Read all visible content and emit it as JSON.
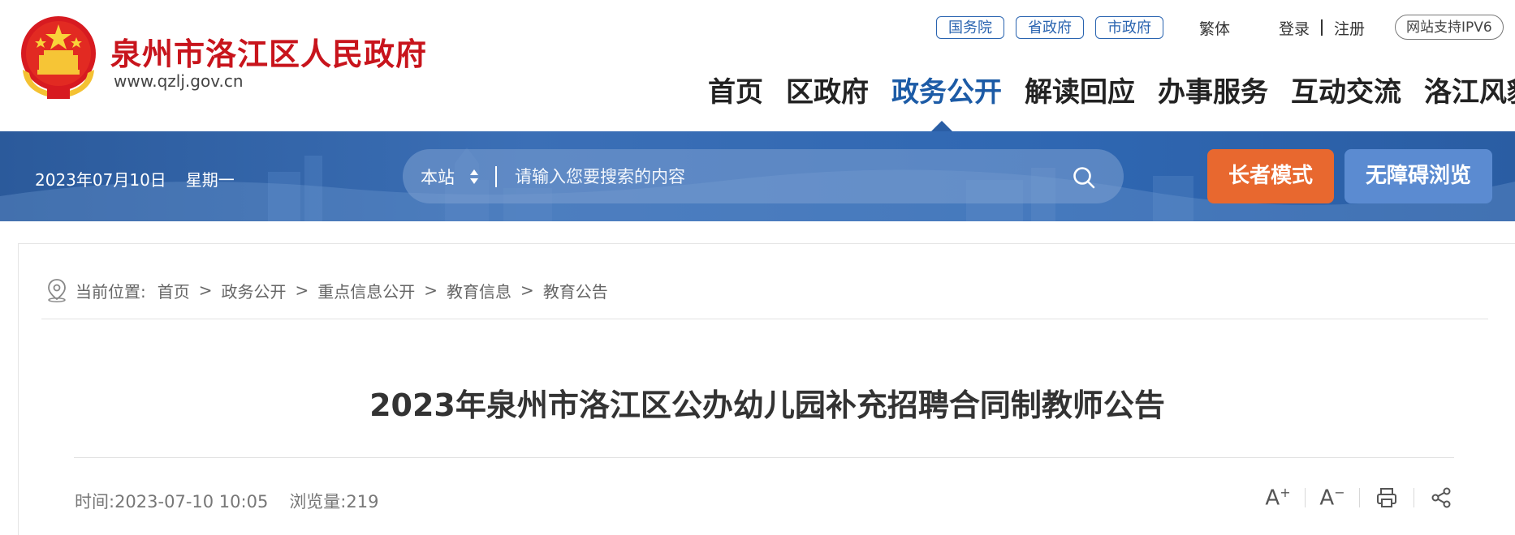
{
  "header": {
    "site_name": "泉州市洛江区人民政府",
    "site_url": "www.qzlj.gov.cn",
    "pills": [
      "国务院",
      "省政府",
      "市政府"
    ],
    "traditional": "繁体",
    "login": "登录",
    "register": "注册",
    "ipv6": "网站支持IPV6"
  },
  "nav": {
    "items": [
      "首页",
      "区政府",
      "政务公开",
      "解读回应",
      "办事服务",
      "互动交流",
      "洛江风貌"
    ],
    "active": "政务公开"
  },
  "bar": {
    "date": "2023年07月10日",
    "weekday": "星期一",
    "search_scope": "本站",
    "search_placeholder": "请输入您要搜索的内容",
    "elder_mode": "长者模式",
    "accessible": "无障碍浏览"
  },
  "breadcrumb": {
    "label": "当前位置:",
    "items": [
      "首页",
      "政务公开",
      "重点信息公开",
      "教育信息",
      "教育公告"
    ],
    "separator": ">"
  },
  "article": {
    "title": "2023年泉州市洛江区公办幼儿园补充招聘合同制教师公告",
    "time": "时间:2023-07-10 10:05",
    "views": "浏览量:219"
  },
  "tools": {
    "font_up": "A",
    "font_up_sign": "+",
    "font_down": "A",
    "font_down_sign": "−"
  },
  "colors": {
    "brand_red": "#c8141c",
    "nav_blue": "#1c5ba6",
    "elder_orange": "#e8682f",
    "access_blue": "#5b8bd1"
  }
}
